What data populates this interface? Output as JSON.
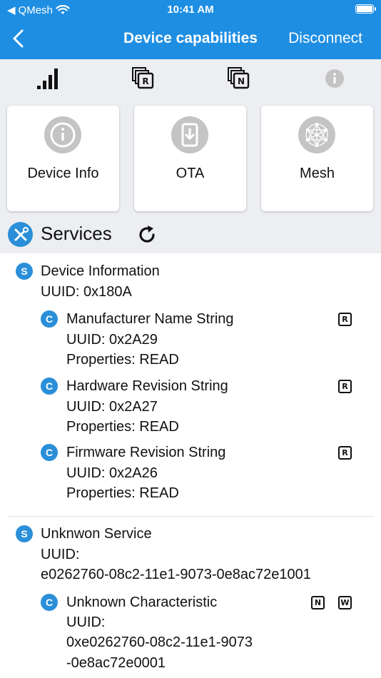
{
  "status_bar": {
    "back_app": "QMesh",
    "time": "10:41 AM"
  },
  "nav": {
    "title": "Device capabilities",
    "right_action": "Disconnect"
  },
  "toolbar": {
    "icons": [
      "signal-strength-icon",
      "read-filter-icon",
      "notify-filter-icon",
      "info-icon"
    ],
    "read_letter": "R",
    "notify_letter": "N"
  },
  "cards": [
    {
      "label": "Device Info",
      "icon": "info-icon"
    },
    {
      "label": "OTA",
      "icon": "ota-update-icon"
    },
    {
      "label": "Mesh",
      "icon": "mesh-network-icon"
    }
  ],
  "services_header": {
    "title": "Services"
  },
  "services": [
    {
      "badge": "S",
      "name": "Device Information",
      "uuid": "UUID: 0x180A",
      "characteristics": [
        {
          "badge": "C",
          "name": "Manufacturer Name String",
          "uuid": "UUID: 0x2A29",
          "properties": "Properties: READ",
          "flags": [
            "R"
          ]
        },
        {
          "badge": "C",
          "name": "Hardware Revision String",
          "uuid": "UUID: 0x2A27",
          "properties": "Properties: READ",
          "flags": [
            "R"
          ]
        },
        {
          "badge": "C",
          "name": "Firmware Revision String",
          "uuid": "UUID: 0x2A26",
          "properties": "Properties: READ",
          "flags": [
            "R"
          ]
        }
      ]
    },
    {
      "badge": "S",
      "name": "Unknwon Service",
      "uuid_label": "UUID:",
      "uuid_value": "e0262760-08c2-11e1-9073-0e8ac72e1001",
      "characteristics": [
        {
          "badge": "C",
          "name": "Unknown Characteristic",
          "uuid_label": "UUID:",
          "uuid_line1": "0xe0262760-08c2-11e1-9073",
          "uuid_line2": "-0e8ac72e0001",
          "flags": [
            "N",
            "W"
          ]
        }
      ]
    }
  ],
  "colors": {
    "accent": "#1e8ee3",
    "badge": "#2a8fd8",
    "toolbar_bg": "#eceef1",
    "card_icon": "#c4c4c4"
  }
}
